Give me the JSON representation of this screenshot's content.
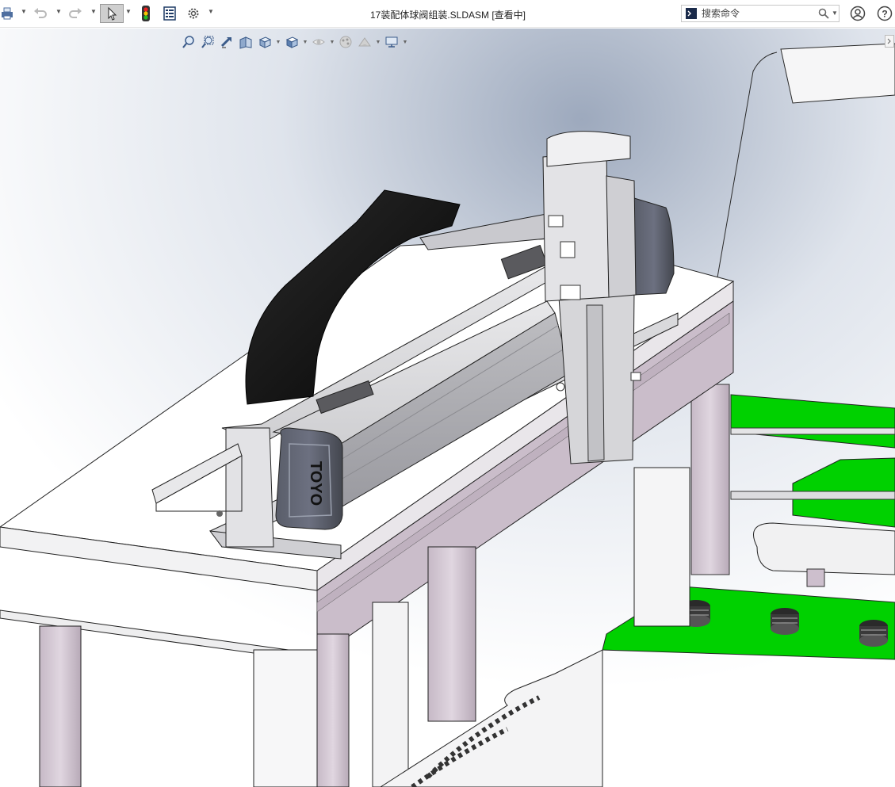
{
  "window": {
    "title": "17装配体球阀组装.SLDASM [查看中]"
  },
  "search": {
    "placeholder": "搜索命令"
  },
  "toolbar": {
    "icons": [
      "print-icon",
      "undo-icon",
      "redo-icon",
      "select-cursor-icon",
      "rebuild-icon",
      "file-properties-icon",
      "options-gear-icon"
    ]
  },
  "heads_up_toolbar": {
    "icons": [
      "zoom-to-fit-icon",
      "zoom-to-area-icon",
      "previous-view-icon",
      "section-view-icon",
      "view-orientation-icon",
      "display-style-icon",
      "hide-show-items-icon",
      "edit-appearance-icon",
      "apply-scene-icon",
      "view-settings-icon"
    ]
  },
  "model_logo": {
    "text": "TOYO"
  },
  "colors": {
    "accent_green": "#00d100",
    "frame_lilac": "#c9bcc9",
    "rail_gray": "#c4c4c7",
    "cable_black": "#111111"
  }
}
